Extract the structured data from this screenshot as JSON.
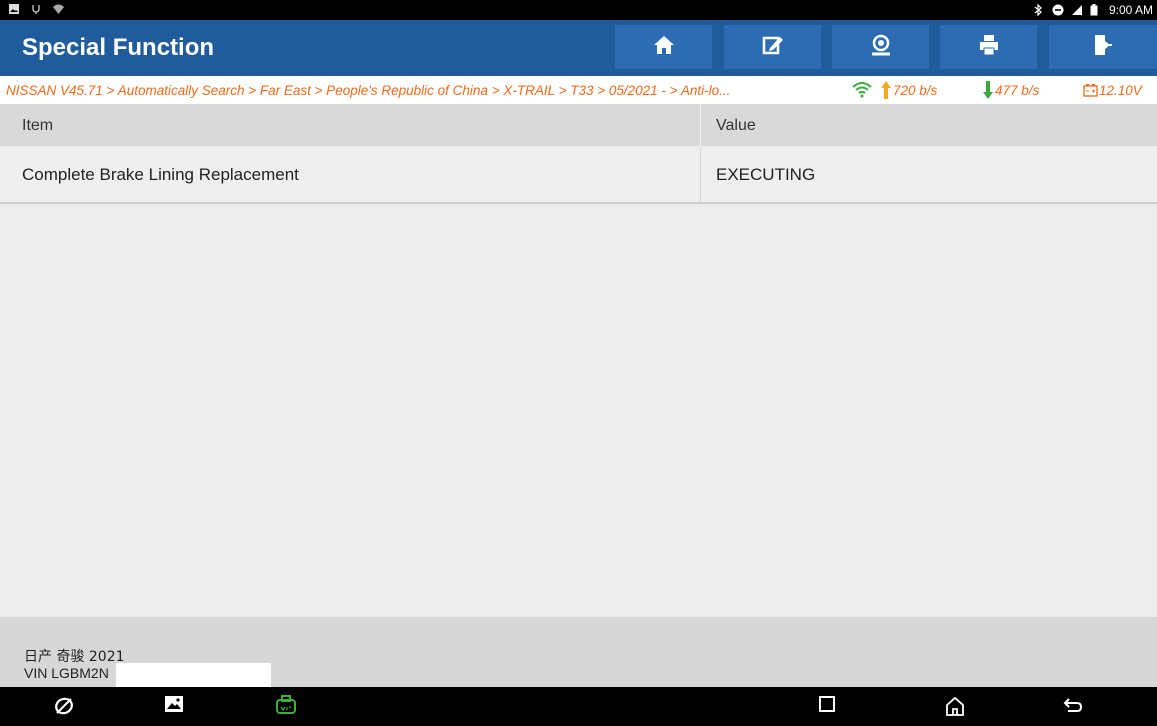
{
  "status_bar": {
    "time": "9:00 AM"
  },
  "header": {
    "title": "Special Function",
    "buttons": [
      "home-icon",
      "edit-report-icon",
      "remote-support-icon",
      "print-icon",
      "exit-icon"
    ]
  },
  "breadcrumb": {
    "path": "NISSAN V45.71 > Automatically Search > Far East > People's Republic of China > X-TRAIL > T33 > 05/2021 - > Anti-lo...",
    "upload_rate": "720 b/s",
    "download_rate": "477 b/s",
    "voltage": "12.10V"
  },
  "table": {
    "columns": [
      "Item",
      "Value"
    ],
    "rows": [
      {
        "item": "Complete Brake Lining Replacement",
        "value": "EXECUTING"
      }
    ]
  },
  "footer": {
    "model": "日产 奇骏 2021",
    "vin": "VIN LGBM2N"
  },
  "nav_bar": {
    "buttons": [
      "browser-icon",
      "gallery-icon",
      "vci-icon",
      "recent-apps-icon",
      "home-icon",
      "back-icon"
    ]
  },
  "colors": {
    "header_bg": "#205b9b",
    "header_button_bg": "#2d6cb2",
    "breadcrumb_text": "#f06a1a",
    "download_arrow": "#3aa83a",
    "upload_arrow": "#f5a623",
    "vci_icon": "#3ab03a"
  }
}
